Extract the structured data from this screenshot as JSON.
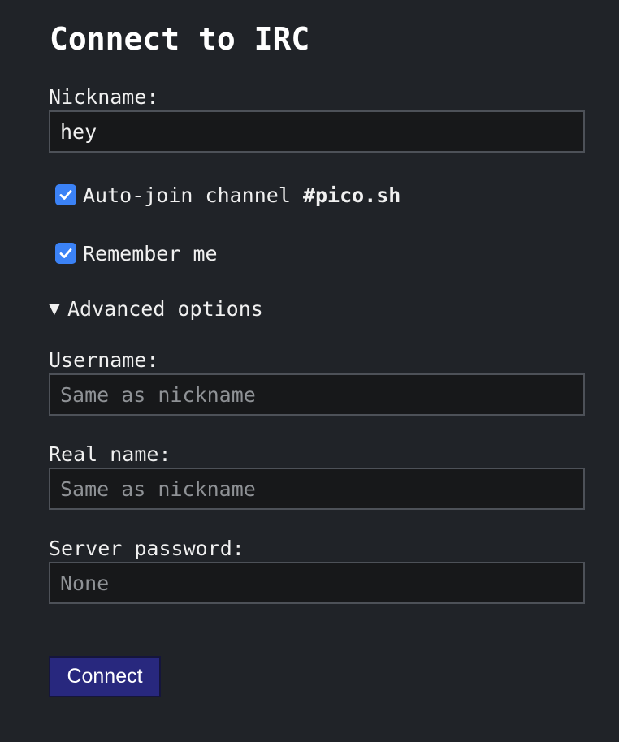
{
  "title": "Connect to IRC",
  "nickname": {
    "label": "Nickname:",
    "value": "hey"
  },
  "auto_join": {
    "checked": true,
    "label_prefix": "Auto-join channel ",
    "channel": "#pico.sh"
  },
  "remember_me": {
    "checked": true,
    "label": "Remember me"
  },
  "advanced": {
    "expanded": true,
    "toggle_glyph": "▼",
    "label": "Advanced options"
  },
  "username": {
    "label": "Username:",
    "placeholder": "Same as nickname"
  },
  "realname": {
    "label": "Real name:",
    "placeholder": "Same as nickname"
  },
  "password": {
    "label": "Server password:",
    "placeholder": "None"
  },
  "connect_button": {
    "label": "Connect"
  },
  "colors": {
    "background": "#202328",
    "input_background": "#17181a",
    "checkbox_accent": "#3b82f6",
    "button_background": "#28287e"
  }
}
